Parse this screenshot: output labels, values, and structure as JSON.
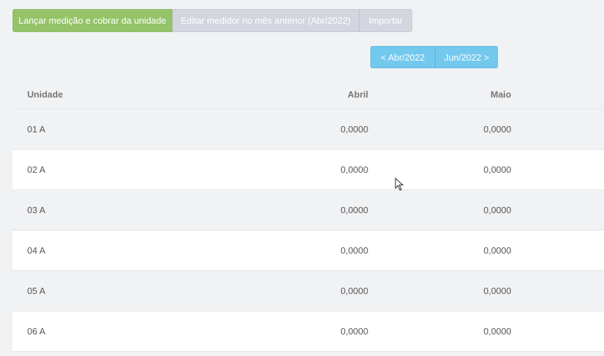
{
  "toolbar": {
    "launch_label": "Lançar medição e cobrar da unidade",
    "edit_label": "Editar medidor no mês anterior (Abr/2022)",
    "import_label": "Importar"
  },
  "period_nav": {
    "prev_label": "< Abr/2022",
    "next_label": "Jun/2022 >"
  },
  "table": {
    "headers": {
      "unit": "Unidade",
      "april": "Abril",
      "may": "Maio"
    },
    "rows": [
      {
        "unit": "01 A",
        "april": "0,0000",
        "may": "0,0000"
      },
      {
        "unit": "02 A",
        "april": "0,0000",
        "may": "0,0000"
      },
      {
        "unit": "03 A",
        "april": "0,0000",
        "may": "0,0000"
      },
      {
        "unit": "04 A",
        "april": "0,0000",
        "may": "0,0000"
      },
      {
        "unit": "05 A",
        "april": "0,0000",
        "may": "0,0000"
      },
      {
        "unit": "06 A",
        "april": "0,0000",
        "may": "0,0000"
      }
    ]
  },
  "colors": {
    "primary_green": "#95c468",
    "disabled_gray": "#d3d6de",
    "nav_blue": "#73c8ee"
  }
}
